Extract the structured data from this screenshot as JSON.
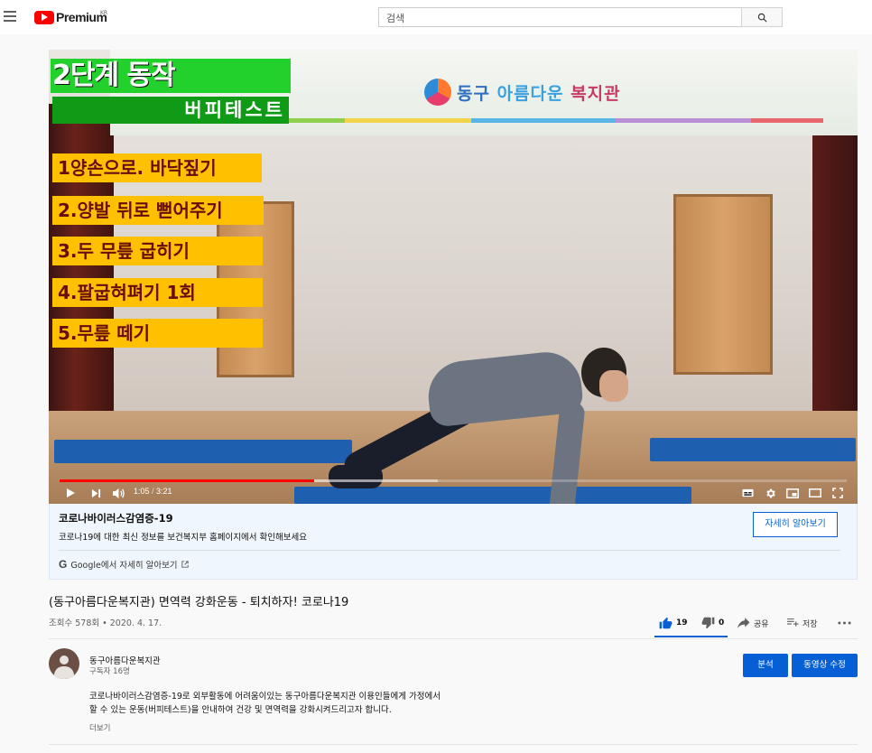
{
  "header": {
    "logo_text": "Premium",
    "region": "KR",
    "search_placeholder": "검색"
  },
  "video_overlay": {
    "banner_org": [
      "동구",
      "아름다운",
      "복지관"
    ],
    "title": "2단계 동작",
    "subtitle": "버피테스트",
    "steps": [
      "1양손으로. 바닥짚기",
      "2.양발 뒤로 뻗어주기",
      "3.두 무릎 굽히기",
      "4.팔굽혀펴기 1회",
      "5.무릎 떼기"
    ]
  },
  "player": {
    "current_time": "1:05",
    "duration": "3:21",
    "progress": 0.323,
    "buffered": 0.48
  },
  "covid_panel": {
    "title": "코로나바이러스감염증-19",
    "description": "코로나19에 대한 최신 정보를 보건복지부 홈페이지에서 확인해보세요",
    "button_label": "자세히 알아보기",
    "google_label": "Google에서 자세히 알아보기"
  },
  "video": {
    "title": "(동구아름다운복지관) 면역력 강화운동 - 퇴치하자! 코로나19",
    "meta": "조회수 578회 • 2020. 4. 17.",
    "likes": "19",
    "dislikes": "0",
    "share_label": "공유",
    "save_label": "저장"
  },
  "channel": {
    "name": "동구아름다운복지관",
    "subscribers": "구독자 16명",
    "analytics_label": "분석",
    "edit_label": "동영상 수정"
  },
  "description": {
    "line1": "코로나바이러스감염증-19로 외부활동에 어려움이있는 동구아름다운복지관 이용인들에게 가정에서",
    "line2": "할 수 있는 운동(버피테스트)을 안내하여 건강 및 면역력을 강화시켜드리고자 합니다.",
    "more_label": "더보기"
  },
  "colors": {
    "accent": "#065fd4",
    "brand_red": "#ff0000",
    "step_card": "#ffc000",
    "title_card": "#22d12b"
  }
}
